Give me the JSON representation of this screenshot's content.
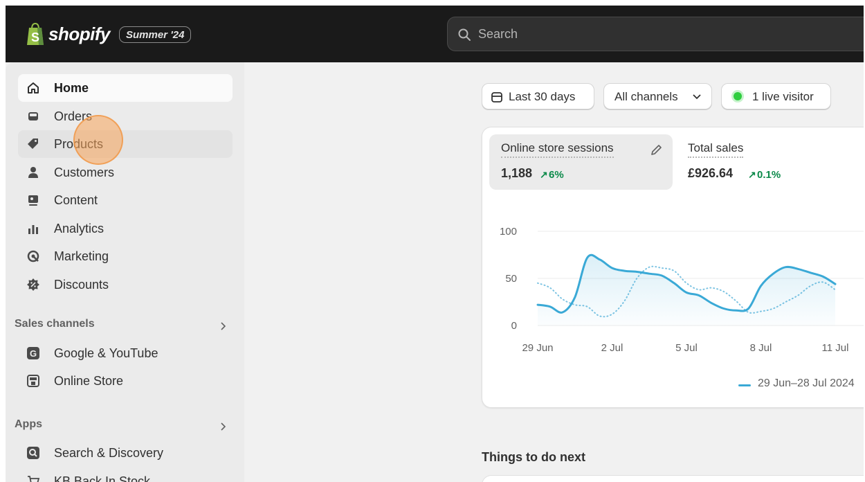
{
  "topbar": {
    "logo_text": "shopify",
    "edition": "Summer '24",
    "search_placeholder": "Search"
  },
  "sidebar": {
    "items": [
      {
        "label": "Home",
        "icon": "home-icon"
      },
      {
        "label": "Orders",
        "icon": "inbox-icon"
      },
      {
        "label": "Products",
        "icon": "tag-icon"
      },
      {
        "label": "Customers",
        "icon": "person-icon"
      },
      {
        "label": "Content",
        "icon": "content-icon"
      },
      {
        "label": "Analytics",
        "icon": "bar-chart-icon"
      },
      {
        "label": "Marketing",
        "icon": "target-icon"
      },
      {
        "label": "Discounts",
        "icon": "discount-icon"
      }
    ],
    "sales_channels_title": "Sales channels",
    "channels": [
      {
        "label": "Google & YouTube",
        "icon": "google-icon"
      },
      {
        "label": "Online Store",
        "icon": "store-icon"
      }
    ],
    "apps_title": "Apps",
    "apps": [
      {
        "label": "Search & Discovery",
        "icon": "search-app-icon"
      },
      {
        "label": "KB Back In Stock",
        "icon": "cart-icon"
      }
    ]
  },
  "filters": {
    "date_range": "Last 30 days",
    "channels": "All channels",
    "live_visitors": "1 live visitor"
  },
  "metrics": [
    {
      "name": "Online store sessions",
      "value": "1,188",
      "change": "6%"
    },
    {
      "name": "Total sales",
      "value": "£926.64",
      "change": "0.1%"
    }
  ],
  "chart_data": {
    "type": "line",
    "x_ticks": [
      "29 Jun",
      "2 Jul",
      "5 Jul",
      "8 Jul",
      "11 Jul"
    ],
    "y_ticks": [
      "100",
      "50",
      "0"
    ],
    "ylim": [
      0,
      100
    ],
    "legend": "29 Jun–28 Jul 2024",
    "series": [
      {
        "name": "29 Jun–28 Jul 2024",
        "style": "solid",
        "color": "#3aa9d6",
        "x": [
          0,
          0.5,
          1,
          1.5,
          2,
          2.5,
          3,
          3.5,
          4,
          4.5,
          5,
          5.5,
          6,
          6.5,
          7,
          7.5,
          8,
          8.5,
          9,
          9.5,
          10,
          10.5,
          11,
          11.5,
          12
        ],
        "values": [
          22,
          20,
          14,
          30,
          72,
          70,
          61,
          58,
          57,
          55,
          53,
          45,
          35,
          32,
          24,
          18,
          16,
          18,
          42,
          55,
          62,
          60,
          56,
          52,
          44
        ]
      },
      {
        "name": "",
        "style": "dotted",
        "color": "#7cc3e2",
        "x": [
          0,
          0.5,
          1,
          1.5,
          2,
          2.5,
          3,
          3.5,
          4,
          4.5,
          5,
          5.5,
          6,
          6.5,
          7,
          7.5,
          8,
          8.5,
          9,
          9.5,
          10,
          10.5,
          11,
          11.5,
          12
        ],
        "values": [
          45,
          40,
          28,
          22,
          20,
          10,
          12,
          26,
          50,
          62,
          61,
          58,
          45,
          38,
          40,
          36,
          26,
          14,
          15,
          18,
          25,
          32,
          42,
          46,
          38
        ]
      }
    ]
  },
  "next_section_title": "Things to do next"
}
